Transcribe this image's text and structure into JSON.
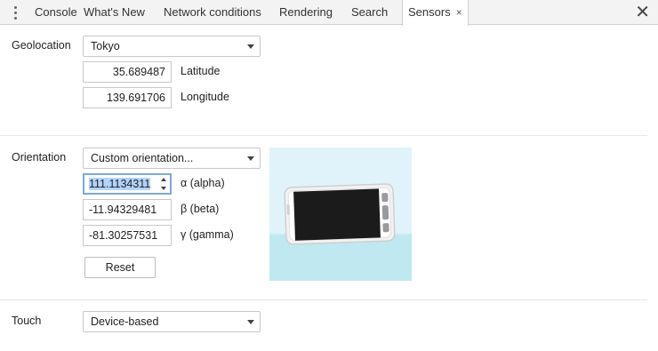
{
  "tabs": [
    {
      "label": "Console"
    },
    {
      "label": "What's New"
    },
    {
      "label": "Network conditions"
    },
    {
      "label": "Rendering"
    },
    {
      "label": "Search"
    },
    {
      "label": "Sensors"
    }
  ],
  "active_tab": "Sensors",
  "icons": {
    "more": "kebab-vertical-icon",
    "tab_close": "×",
    "drawer_close": "✕"
  },
  "geolocation": {
    "label": "Geolocation",
    "selected": "Tokyo",
    "latitude_value": "35.689487",
    "latitude_label": "Latitude",
    "longitude_value": "139.691706",
    "longitude_label": "Longitude"
  },
  "orientation": {
    "label": "Orientation",
    "selected": "Custom orientation...",
    "alpha_value": "111.1134311",
    "alpha_label": "α (alpha)",
    "beta_value": "-11.94329481",
    "beta_label": "β (beta)",
    "gamma_value": "-81.30257531",
    "gamma_label": "γ (gamma)",
    "reset_label": "Reset"
  },
  "touch": {
    "label": "Touch",
    "selected": "Device-based"
  },
  "colors": {
    "preview_sky": "#e1f3fa",
    "preview_floor": "#bfe8f0",
    "device_screen": "#1b1b1b",
    "focus_ring": "#7fa8d9"
  }
}
